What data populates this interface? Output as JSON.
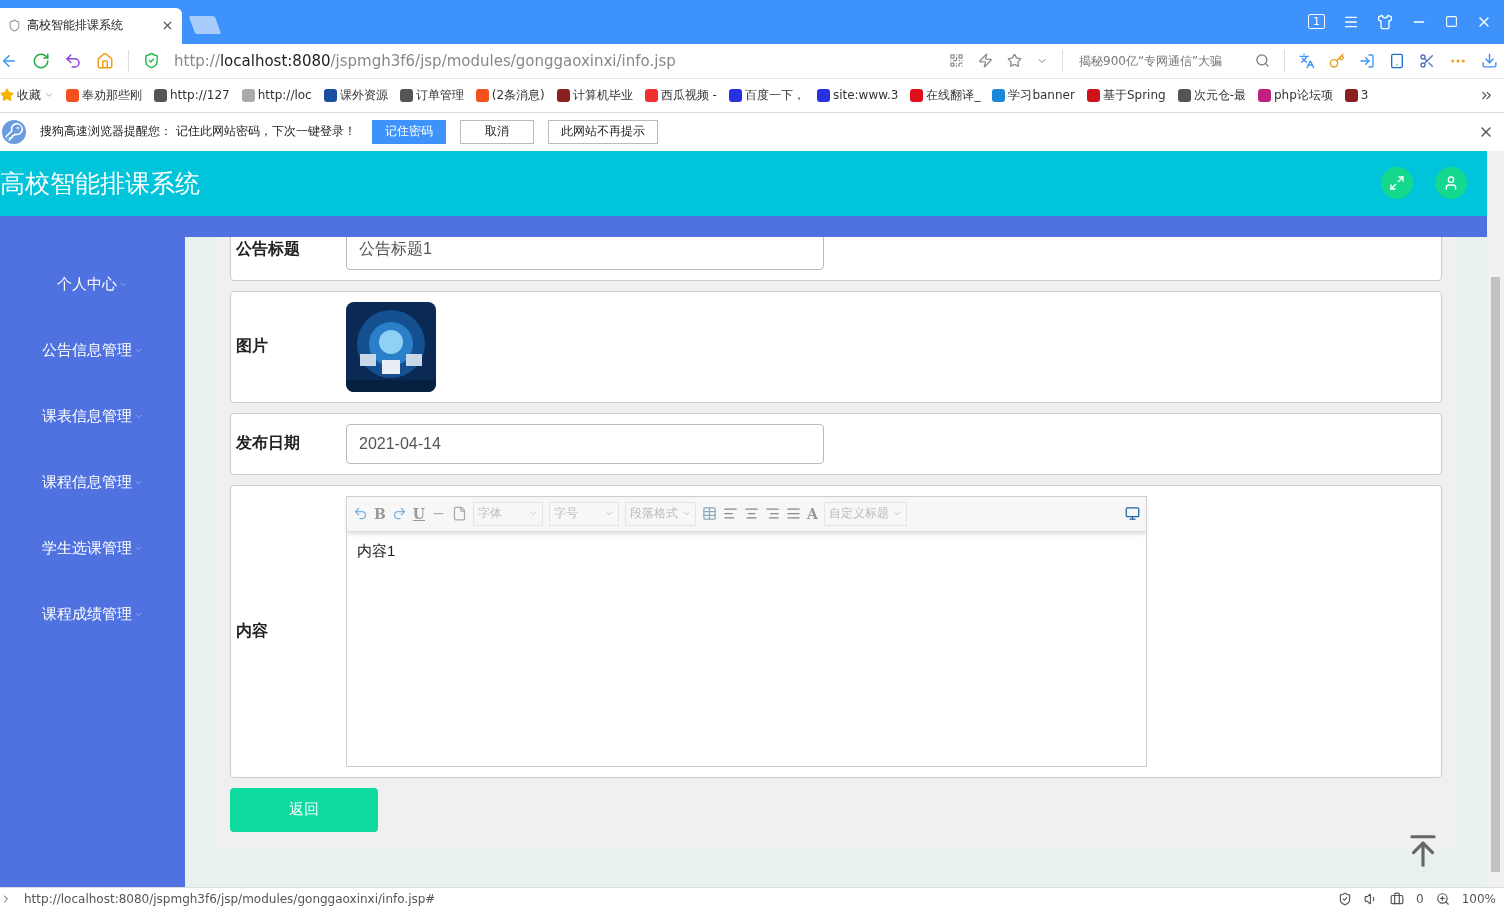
{
  "browser": {
    "tab": {
      "title": "高校智能排课系统",
      "selected": true
    },
    "window_count": "1",
    "address": "http://**localhost:8080**/jspmgh3f6/jsp/modules/gonggaoxinxi/info.jsp",
    "search": {
      "placeholder": "揭秘900亿“专网通信”大骗"
    },
    "bookmarks": [
      {
        "kind": "folder",
        "label": "收藏",
        "color": "#f5b400"
      },
      {
        "kind": "site",
        "label": "奉劝那些刚",
        "color": "#f4511e"
      },
      {
        "kind": "site",
        "label": "http://127",
        "color": "#555555"
      },
      {
        "kind": "site",
        "label": "http://loc",
        "color": "#aaaaaa"
      },
      {
        "kind": "site",
        "label": "课外资源",
        "color": "#1a4fa0"
      },
      {
        "kind": "site",
        "label": "订单管理",
        "color": "#555555"
      },
      {
        "kind": "site",
        "label": "(2条消息)",
        "color": "#f4511e"
      },
      {
        "kind": "site",
        "label": "计算机毕业",
        "color": "#8b2020"
      },
      {
        "kind": "site",
        "label": "西瓜视频 -",
        "color": "#f03030"
      },
      {
        "kind": "site",
        "label": "百度一下，",
        "color": "#2932e1"
      },
      {
        "kind": "site",
        "label": "site:www.3",
        "color": "#2932e1"
      },
      {
        "kind": "site",
        "label": "在线翻译_",
        "color": "#e0101a"
      },
      {
        "kind": "site",
        "label": "学习banner",
        "color": "#1a8ad8"
      },
      {
        "kind": "site",
        "label": "基于Spring",
        "color": "#d0101a"
      },
      {
        "kind": "site",
        "label": "次元仓-最",
        "color": "#555555"
      },
      {
        "kind": "site",
        "label": "php论坛项",
        "color": "#c02080"
      },
      {
        "kind": "site",
        "label": "3",
        "color": "#8b2020"
      }
    ],
    "notice": {
      "text": "搜狗高速浏览器提醒您： 记住此网站密码，下次一键登录！",
      "buttons": [
        {
          "label": "记住密码",
          "kind": "primary"
        },
        {
          "label": "取消",
          "kind": "plain"
        },
        {
          "label": "此网站不再提示",
          "kind": "plain"
        }
      ]
    }
  },
  "app": {
    "title": "高校智能排课系统",
    "menu": [
      {
        "label": "个人中心"
      },
      {
        "label": "公告信息管理"
      },
      {
        "label": "课表信息管理"
      },
      {
        "label": "课程信息管理"
      },
      {
        "label": "学生选课管理"
      },
      {
        "label": "课程成绩管理"
      }
    ],
    "fields": [
      {
        "kind": "input",
        "label": "公告标题",
        "value": "公告标题1"
      },
      {
        "label": "图片"
      },
      {
        "kind": "input",
        "label": "发布日期",
        "value": "2021-04-14"
      },
      {
        "kind": "editor",
        "label": "内容",
        "value": "内容1"
      }
    ],
    "toolbar": [
      {
        "kind": "undo"
      },
      {
        "kind": "glyph",
        "label": "B"
      },
      {
        "kind": "redo"
      },
      {
        "kind": "underline",
        "label": "U"
      },
      {
        "kind": "rule"
      },
      {
        "kind": "doc"
      },
      {
        "kind": "select",
        "label": "字体"
      },
      {
        "kind": "select",
        "label": "字号"
      },
      {
        "kind": "select",
        "label": "段落格式"
      },
      {
        "kind": "table"
      },
      {
        "kind": "align-left"
      },
      {
        "kind": "align-center"
      },
      {
        "kind": "align-right"
      },
      {
        "kind": "justify"
      },
      {
        "kind": "color",
        "label": "A"
      },
      {
        "kind": "select",
        "label": "自定义标题"
      },
      {
        "kind": "fullscreen"
      }
    ],
    "back_button": "返回"
  },
  "status_bar": {
    "url": "http://localhost:8080/jspmgh3f6/jsp/modules/gonggaoxinxi/info.jsp#",
    "blocked": "0",
    "zoom": "100%"
  }
}
